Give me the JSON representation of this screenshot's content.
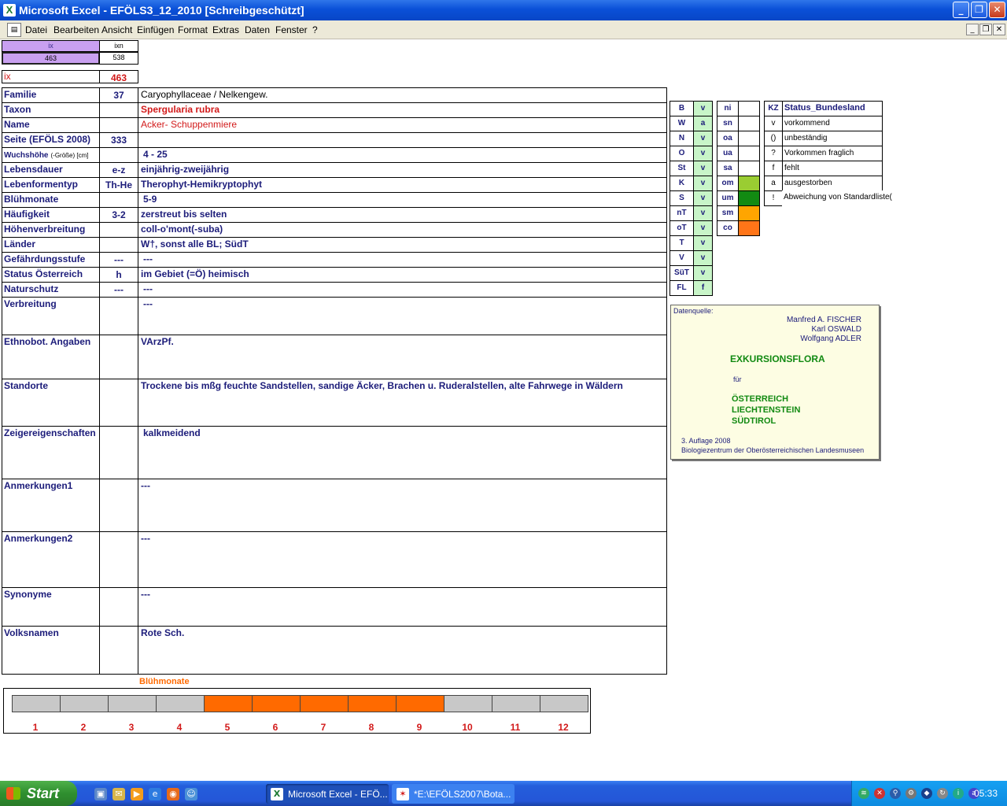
{
  "window": {
    "title": "Microsoft Excel - EFÖLS3_12_2010  [Schreibgeschützt]",
    "app_icon": "excel-icon",
    "min": "_",
    "max": "❐",
    "close": "✕"
  },
  "menu": {
    "items": [
      "Datei",
      "Bearbeiten",
      "Ansicht",
      "Einfügen",
      "Format",
      "Extras",
      "Daten",
      "Fenster",
      "?"
    ],
    "doc_min": "_",
    "doc_restore": "❐",
    "doc_close": "✕"
  },
  "top": {
    "ix_label": "ix",
    "ixn_label": "ixn",
    "ix_value": "463",
    "ixn_value": "538",
    "ix_big_label": "ix",
    "ix_big_value": "463"
  },
  "rows": [
    {
      "label": "Familie",
      "code": "37",
      "value": "Caryophyllaceae  /  Nelkengew."
    },
    {
      "label": "Taxon",
      "code": "",
      "value": "Spergularia rubra"
    },
    {
      "label": "Name",
      "code": "",
      "value": "Acker- Schuppenmiere"
    },
    {
      "label": "Seite (EFÖLS 2008)",
      "code": "333",
      "value": ""
    },
    {
      "label": "Wuchshöhe",
      "label_small": "(-Größe) [cm]",
      "code": "",
      "value": "4 - 25"
    },
    {
      "label": "Lebensdauer",
      "code": "e-z",
      "value": "einjährig-zweijährig"
    },
    {
      "label": "Lebenformentyp",
      "code": "Th-He",
      "value": "Therophyt-Hemikryptophyt"
    },
    {
      "label": "Blühmonate",
      "code": "",
      "value": "5-9"
    },
    {
      "label": "Häufigkeit",
      "code": "3-2",
      "value": "zerstreut bis selten"
    },
    {
      "label": "Höhenverbreitung",
      "code": "",
      "value": "coll-o'mont(-suba)"
    },
    {
      "label": "Länder",
      "code": "",
      "value": "W†, sonst alle BL; SüdT"
    },
    {
      "label": "Gefährdungsstufe",
      "code": "---",
      "value": "---"
    },
    {
      "label": "Status Österreich",
      "code": "h",
      "value": "im Gebiet (=Ö) heimisch"
    },
    {
      "label": "Naturschutz",
      "code": "---",
      "value": "---"
    },
    {
      "label": "Verbreitung",
      "code": "",
      "value": "---"
    },
    {
      "label": "Ethnobot. Angaben",
      "code": "",
      "value": "VArzPf."
    },
    {
      "label": "Standorte",
      "code": "",
      "value": "Trockene bis mßg feuchte Sandstellen, sandige Äcker, Brachen u. Ruderalstellen, alte Fahrwege in Wäldern"
    },
    {
      "label": "Zeigereigenschaften",
      "code": "",
      "value": "kalkmeidend"
    },
    {
      "label": "Anmerkungen1",
      "code": "",
      "value": "---"
    },
    {
      "label": "Anmerkungen2",
      "code": "",
      "value": "---"
    },
    {
      "label": "Synonyme",
      "code": "",
      "value": "---"
    },
    {
      "label": "Volksnamen",
      "code": "",
      "value": "Rote Sch."
    }
  ],
  "states": [
    {
      "k": "B",
      "v": "v"
    },
    {
      "k": "W",
      "v": "a"
    },
    {
      "k": "N",
      "v": "v"
    },
    {
      "k": "O",
      "v": "v"
    },
    {
      "k": "St",
      "v": "v"
    },
    {
      "k": "K",
      "v": "v"
    },
    {
      "k": "S",
      "v": "v"
    },
    {
      "k": "nT",
      "v": "v"
    },
    {
      "k": "oT",
      "v": "v"
    },
    {
      "k": "T",
      "v": "v"
    },
    {
      "k": "V",
      "v": "v"
    },
    {
      "k": "SüT",
      "v": "v"
    },
    {
      "k": "FL",
      "v": "f"
    }
  ],
  "zones": [
    {
      "k": "ni",
      "color": "#ffffff"
    },
    {
      "k": "sn",
      "color": "#ffffff"
    },
    {
      "k": "oa",
      "color": "#ffffff"
    },
    {
      "k": "ua",
      "color": "#ffffff"
    },
    {
      "k": "sa",
      "color": "#ffffff"
    },
    {
      "k": "om",
      "color": "#9acd32"
    },
    {
      "k": "um",
      "color": "#128a12"
    },
    {
      "k": "sm",
      "color": "#ffa500"
    },
    {
      "k": "co",
      "color": "#ff7518"
    }
  ],
  "legend": {
    "header_code": "KZ",
    "header_label": "Status_Bundesland",
    "items": [
      {
        "c": "v",
        "t": "vorkommend"
      },
      {
        "c": "()",
        "t": "unbeständig"
      },
      {
        "c": "?",
        "t": "Vorkommen fraglich"
      },
      {
        "c": "f",
        "t": "fehlt"
      },
      {
        "c": "a",
        "t": "ausgestorben"
      },
      {
        "c": "!",
        "t": "Abweichung von Standardliste(?)"
      }
    ]
  },
  "source": {
    "heading": "Datenquelle:",
    "authors": [
      "Manfred A. FISCHER",
      "Karl OSWALD",
      "Wolfgang ADLER"
    ],
    "title": "EXKURSIONSFLORA",
    "fuer": "für",
    "countries": [
      "ÖSTERREICH",
      "LIECHTENSTEIN",
      "SÜDTIROL"
    ],
    "edition": "3. Auflage 2008",
    "publisher": "Biologiezentrum der Oberösterreichischen Landesmuseen"
  },
  "bloom": {
    "title": "Blühmonate",
    "months": [
      "1",
      "2",
      "3",
      "4",
      "5",
      "6",
      "7",
      "8",
      "9",
      "10",
      "11",
      "12"
    ],
    "active": [
      5,
      6,
      7,
      8,
      9
    ],
    "active_color": "#ff6a00",
    "inactive_color": "#c8c8c8"
  },
  "taskbar": {
    "start": "Start",
    "quicklaunch": [
      "desktop-icon",
      "outlook-icon",
      "media-player-icon",
      "ie-icon",
      "firefox-icon",
      "messenger-icon"
    ],
    "tasks": [
      "Microsoft Excel - EFÖ...",
      "*E:\\EFÖLS2007\\Bota..."
    ],
    "clock": "05:33"
  }
}
